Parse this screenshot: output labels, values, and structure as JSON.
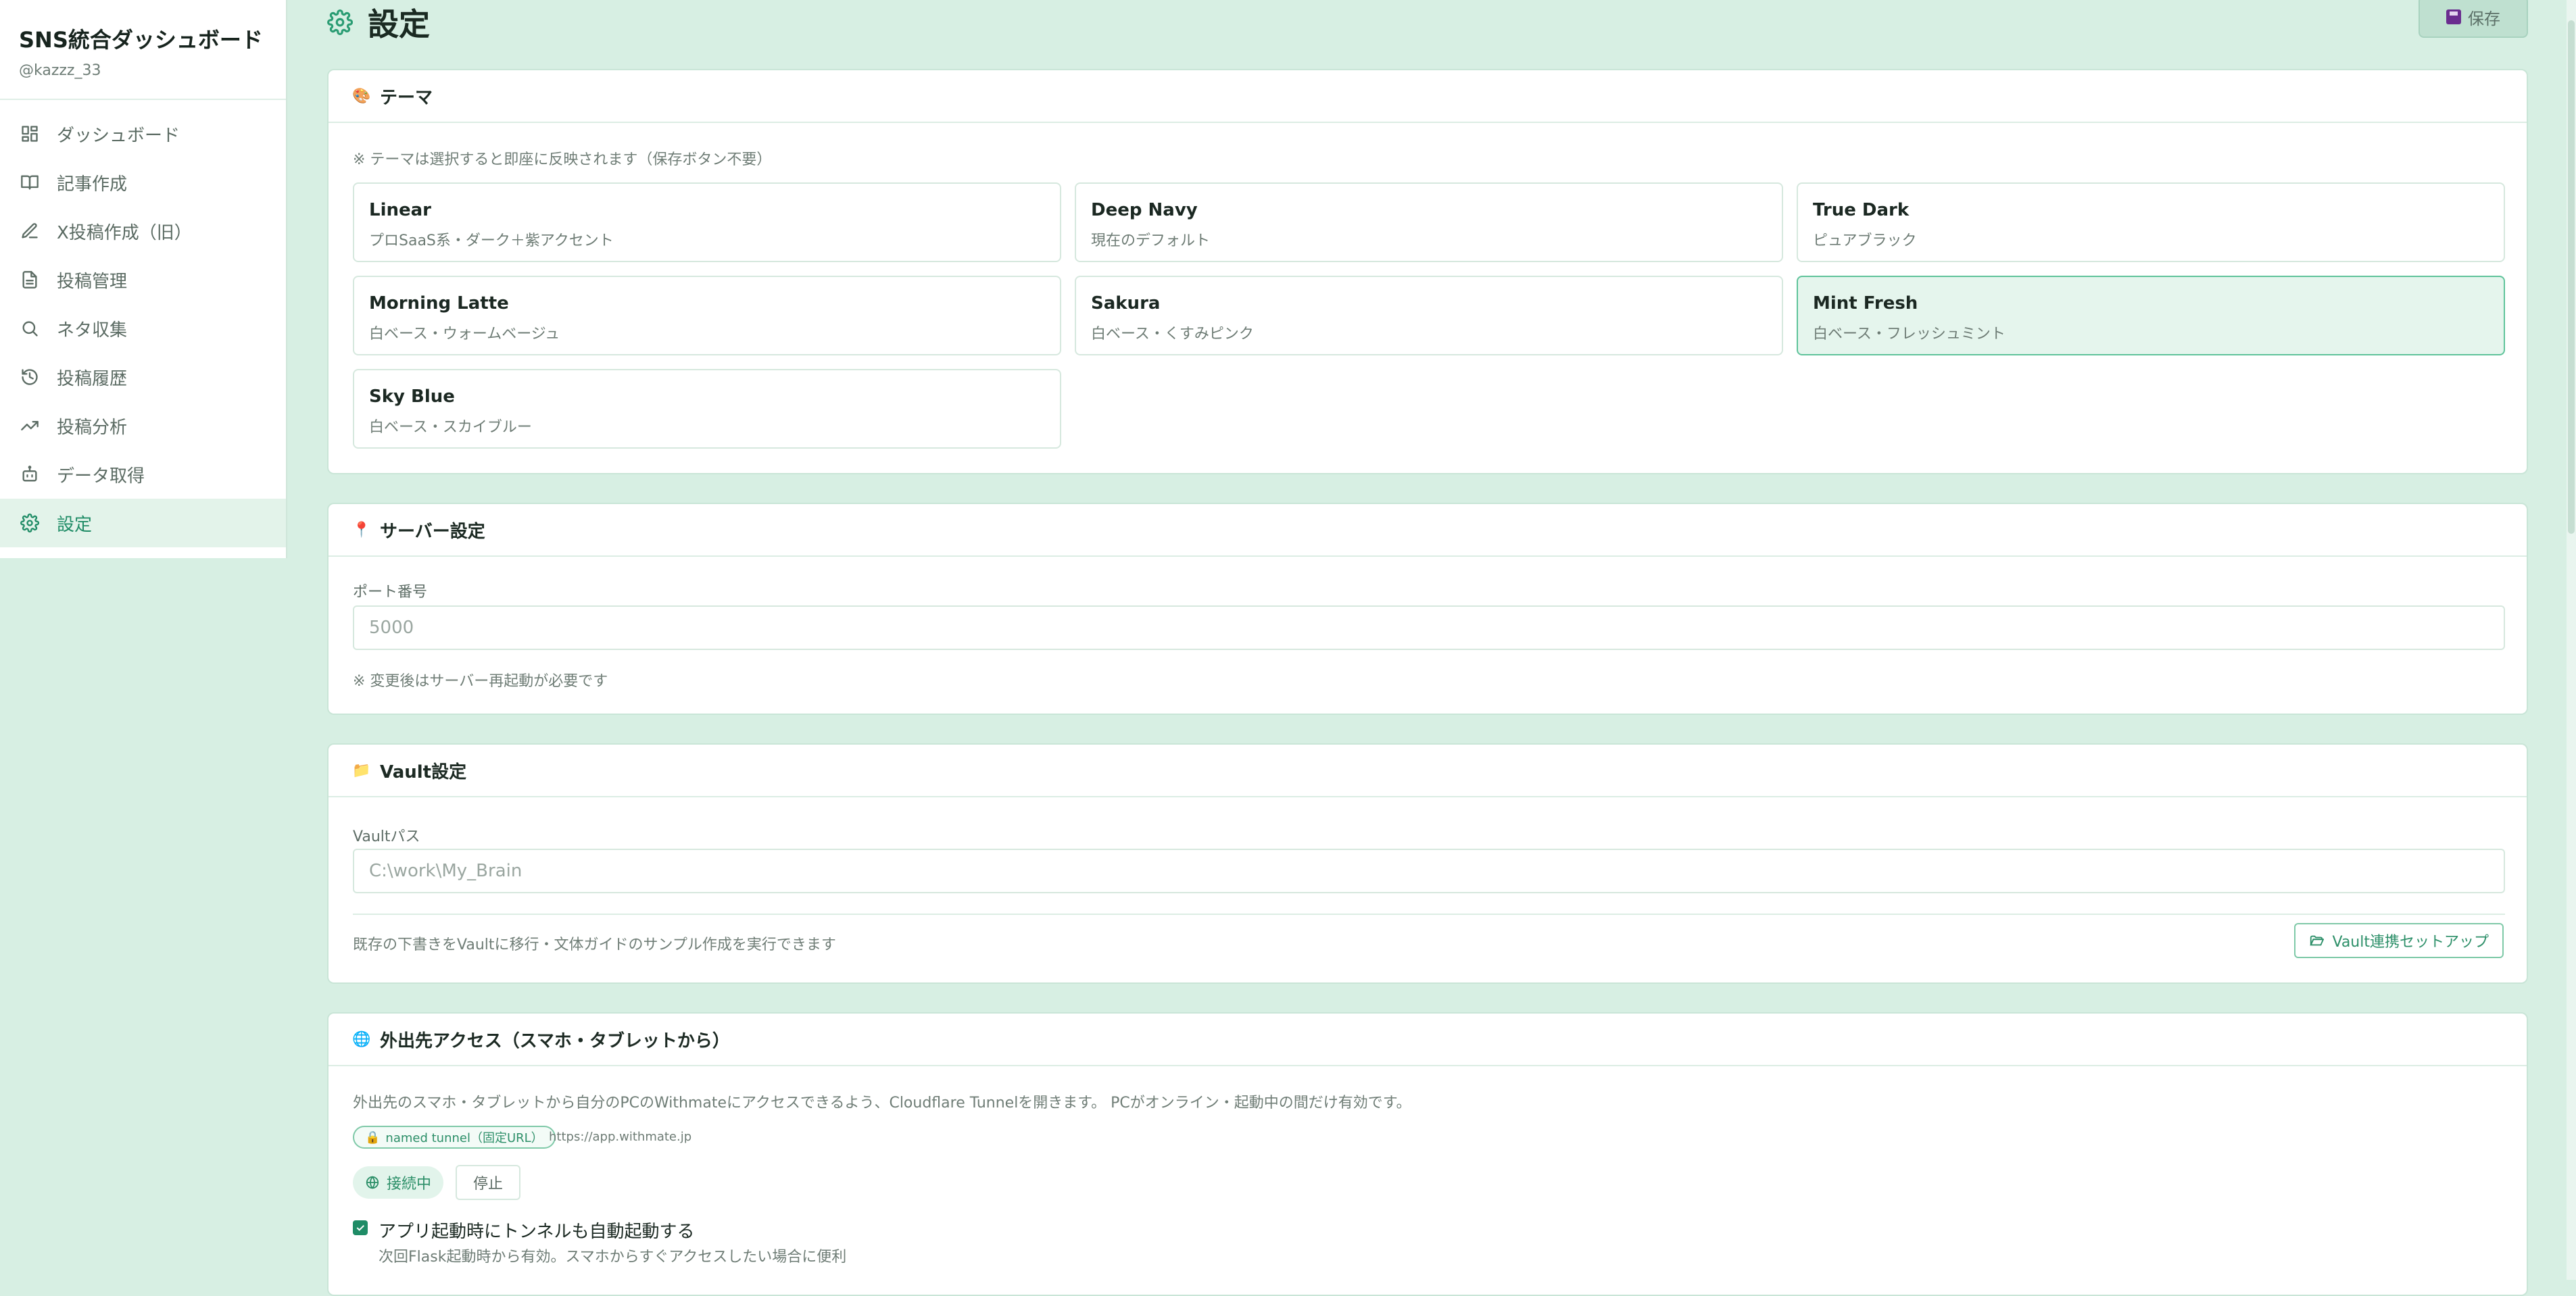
{
  "sidebar": {
    "title": "SNS統合ダッシュボード",
    "user": "@kazzz_33",
    "items": [
      {
        "label": "ダッシュボード",
        "icon": "grid-icon"
      },
      {
        "label": "記事作成",
        "icon": "book-icon"
      },
      {
        "label": "X投稿作成（旧）",
        "icon": "pen-icon"
      },
      {
        "label": "投稿管理",
        "icon": "file-icon"
      },
      {
        "label": "ネタ収集",
        "icon": "search-icon"
      },
      {
        "label": "投稿履歴",
        "icon": "history-icon"
      },
      {
        "label": "投稿分析",
        "icon": "trend-icon"
      },
      {
        "label": "データ取得",
        "icon": "bot-icon"
      },
      {
        "label": "設定",
        "icon": "gear-icon",
        "active": true
      }
    ]
  },
  "header": {
    "title": "設定",
    "save_label": "保存"
  },
  "theme": {
    "title": "テーマ",
    "note": "※ テーマは選択すると即座に反映されます（保存ボタン不要）",
    "options": [
      {
        "name": "Linear",
        "desc": "プロSaaS系・ダーク＋紫アクセント"
      },
      {
        "name": "Deep Navy",
        "desc": "現在のデフォルト"
      },
      {
        "name": "True Dark",
        "desc": "ピュアブラック"
      },
      {
        "name": "Morning Latte",
        "desc": "白ベース・ウォームベージュ"
      },
      {
        "name": "Sakura",
        "desc": "白ベース・くすみピンク"
      },
      {
        "name": "Mint Fresh",
        "desc": "白ベース・フレッシュミント",
        "selected": true
      },
      {
        "name": "Sky Blue",
        "desc": "白ベース・スカイブルー"
      }
    ]
  },
  "server": {
    "title": "サーバー設定",
    "port_label": "ポート番号",
    "port_placeholder": "5000",
    "note": "※ 変更後はサーバー再起動が必要です"
  },
  "vault": {
    "title": "Vault設定",
    "path_label": "Vaultパス",
    "path_placeholder": "C:\\work\\My_Brain",
    "desc": "既存の下書きをVaultに移行・文体ガイドのサンプル作成を実行できます",
    "setup_button": "Vault連携セットアップ"
  },
  "remote": {
    "title": "外出先アクセス（スマホ・タブレットから）",
    "desc": "外出先のスマホ・タブレットから自分のPCのWithmateにアクセスできるよう、Cloudflare Tunnelを開きます。 PCがオンライン・起動中の間だけ有効です。",
    "tunnel_badge": "named tunnel（固定URL）",
    "url": "https://app.withmate.jp",
    "status": "接続中",
    "stop_button": "停止",
    "autostart_label": "アプリ起動時にトンネルも自動起動する",
    "autostart_help": "次回Flask起動時から有効。スマホからすぐアクセスしたい場合に便利",
    "autostart_checked": true
  },
  "colors": {
    "accent": "#1f8c66",
    "background": "#d7efe3",
    "selected_bg": "#e5f5ed"
  }
}
